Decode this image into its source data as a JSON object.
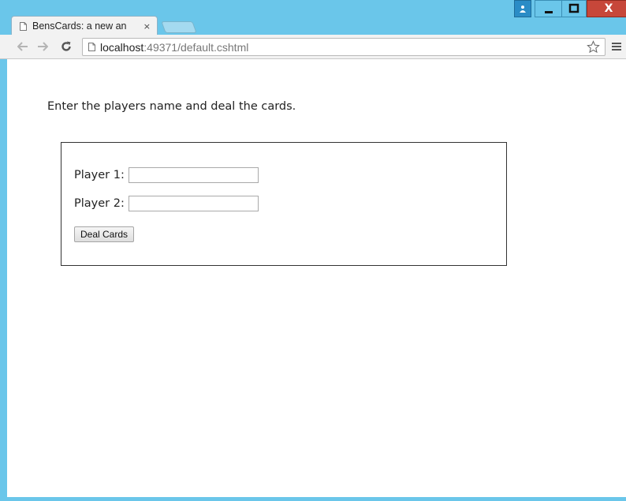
{
  "browser": {
    "tab": {
      "title": "BensCards: a new an",
      "close_glyph": "×"
    },
    "address": {
      "host": "localhost",
      "path": ":49371/default.cshtml"
    },
    "controls": {
      "close_glyph": "X"
    }
  },
  "page": {
    "intro": "Enter the players name and deal the cards.",
    "form": {
      "player1_label": "Player 1:",
      "player1_value": "",
      "player2_label": "Player 2:",
      "player2_value": "",
      "deal_button": "Deal Cards"
    }
  },
  "colors": {
    "frame": "#6ac6ea",
    "close_button": "#c7473a",
    "user_button": "#2a8cc6",
    "page_background": "#ffffff"
  }
}
